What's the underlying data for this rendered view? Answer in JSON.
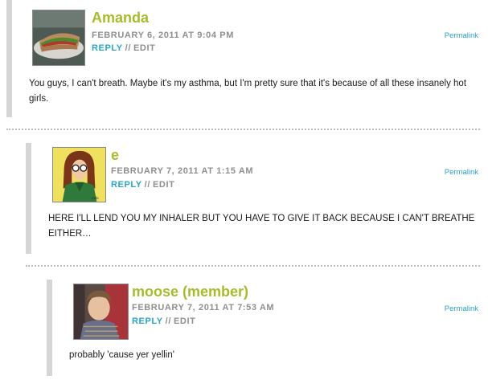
{
  "comments": [
    {
      "author": "Amanda",
      "date": "FEBRUARY 6, 2011 AT 9:04 PM",
      "reply_label": "REPLY",
      "separator": "//",
      "edit_label": "EDIT",
      "permalink_label": "Permalink",
      "avatar_icon": "sandwich-photo-avatar",
      "text": "You guys, I can't breath. Maybe it's my asthma, but I'm pretty sure that it's because of all these insanely hot girls."
    },
    {
      "author": "e",
      "date": "FEBRUARY 7, 2011 AT 1:15 AM",
      "reply_label": "REPLY",
      "separator": "//",
      "edit_label": "EDIT",
      "permalink_label": "Permalink",
      "avatar_icon": "cartoon-girl-avatar",
      "text": "HERE I'LL LEND YOU MY INHALER BUT YOU HAVE TO GIVE IT BACK BECAUSE I CAN'T BREATHE EITHER…"
    },
    {
      "author": "moose (member)",
      "date": "FEBRUARY 7, 2011 AT 7:53 AM",
      "reply_label": "REPLY",
      "separator": "//",
      "edit_label": "EDIT",
      "permalink_label": "Permalink",
      "avatar_icon": "person-photo-avatar",
      "text": "probably 'cause yer yellin'"
    }
  ],
  "colors": {
    "author": "#a3bd2b",
    "link": "#2aa4c8",
    "meta": "#8f8f8f",
    "bar": "#d6d6d6",
    "divider": "#bdbdbd"
  }
}
